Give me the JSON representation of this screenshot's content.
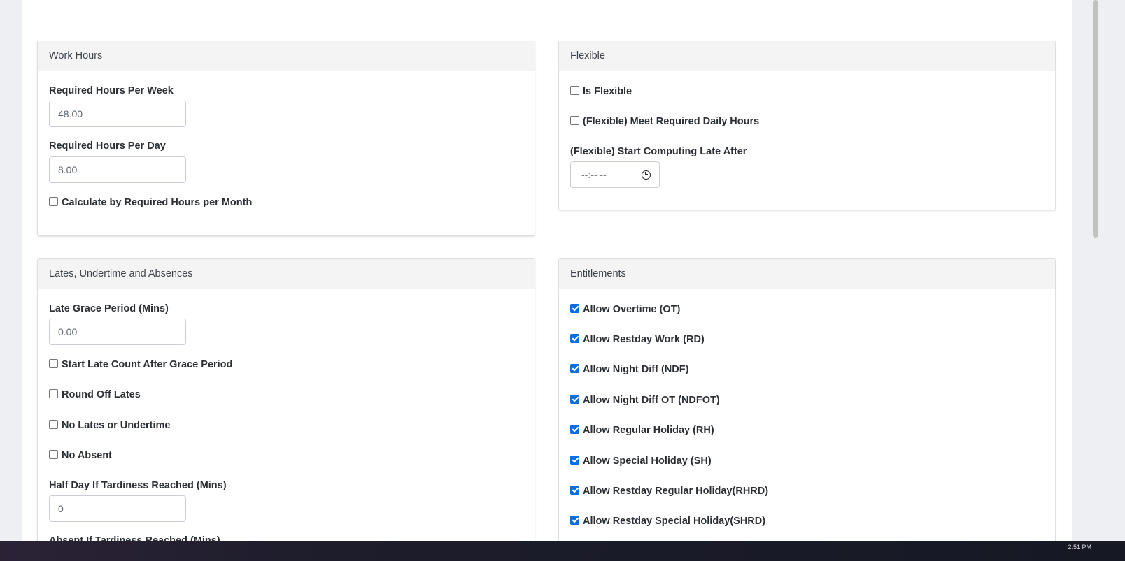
{
  "work_hours": {
    "title": "Work Hours",
    "req_week_label": "Required Hours Per Week",
    "req_week_value": "48.00",
    "req_day_label": "Required Hours Per Day",
    "req_day_value": "8.00",
    "calc_month_label": "Calculate by Required Hours per Month",
    "calc_month_checked": false
  },
  "flexible": {
    "title": "Flexible",
    "is_flexible_label": "Is Flexible",
    "meet_daily_label": "(Flexible) Meet Required Daily Hours",
    "start_late_label": "(Flexible) Start Computing Late After",
    "time_placeholder": "--:-- --"
  },
  "lates": {
    "title": "Lates, Undertime and Absences",
    "grace_label": "Late Grace Period (Mins)",
    "grace_value": "0.00",
    "start_late_after_grace": "Start Late Count After Grace Period",
    "round_off": "Round Off Lates",
    "no_lates": "No Lates or Undertime",
    "no_absent": "No Absent",
    "half_day_label": "Half Day If Tardiness Reached (Mins)",
    "half_day_value": "0",
    "absent_label": "Absent If Tardiness Reached (Mins)"
  },
  "entitlements": {
    "title": "Entitlements",
    "items": [
      {
        "label": "Allow Overtime (OT)",
        "checked": true
      },
      {
        "label": "Allow Restday Work (RD)",
        "checked": true
      },
      {
        "label": "Allow Night Diff (NDF)",
        "checked": true
      },
      {
        "label": "Allow Night Diff OT (NDFOT)",
        "checked": true
      },
      {
        "label": "Allow Regular Holiday (RH)",
        "checked": true
      },
      {
        "label": "Allow Special Holiday (SH)",
        "checked": true
      },
      {
        "label": "Allow Restday Regular Holiday(RHRD)",
        "checked": true
      },
      {
        "label": "Allow Restday Special Holiday(SHRD)",
        "checked": true
      }
    ]
  },
  "taskbar": {
    "time": "2:51 PM"
  },
  "colors": {
    "accent": "#0a6ede",
    "header_bg": "#f4f4f5"
  }
}
